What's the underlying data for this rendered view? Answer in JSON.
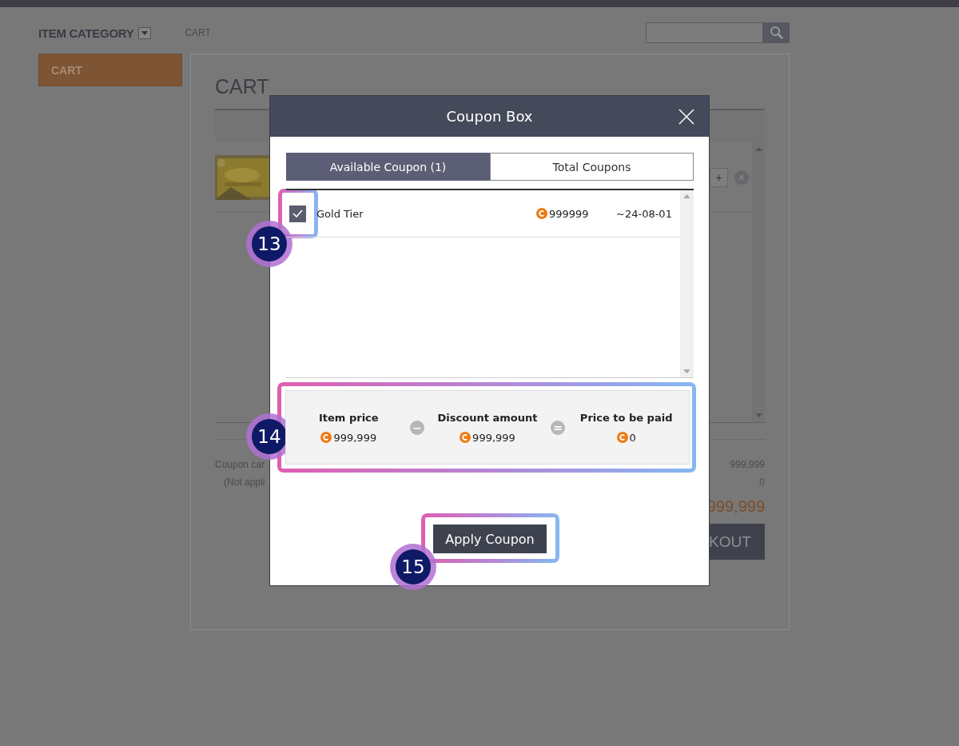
{
  "header": {
    "category": "ITEM CATEGORY",
    "breadcrumb": "CART"
  },
  "sidebar": {
    "items": [
      {
        "label": "CART",
        "selected": true
      }
    ]
  },
  "cart": {
    "title": "CART",
    "quantity_button": "+",
    "summary": [
      {
        "label": "Coupon car",
        "value": "999,999"
      },
      {
        "label": "(Not appli",
        "value": "0"
      }
    ],
    "total": "999,999",
    "checkout": "KOUT"
  },
  "coupon_box": {
    "title": "Coupon Box",
    "tabs": [
      {
        "label": "Available Coupon (1)",
        "selected": true
      },
      {
        "label": "Total Coupons",
        "selected": false
      }
    ],
    "coupons": [
      {
        "name": "Gold Tier",
        "checked": true,
        "amount": "999999",
        "expiry": "~24-08-01"
      }
    ],
    "summary": [
      {
        "label": "Item price",
        "value": "999,999"
      },
      {
        "label": "Discount amount",
        "value": "999,999"
      },
      {
        "label": "Price to be paid",
        "value": "0"
      }
    ],
    "operators": [
      "−",
      "="
    ],
    "apply_button": "Apply Coupon"
  },
  "annotations": [
    {
      "number": "13"
    },
    {
      "number": "14"
    },
    {
      "number": "15"
    }
  ]
}
